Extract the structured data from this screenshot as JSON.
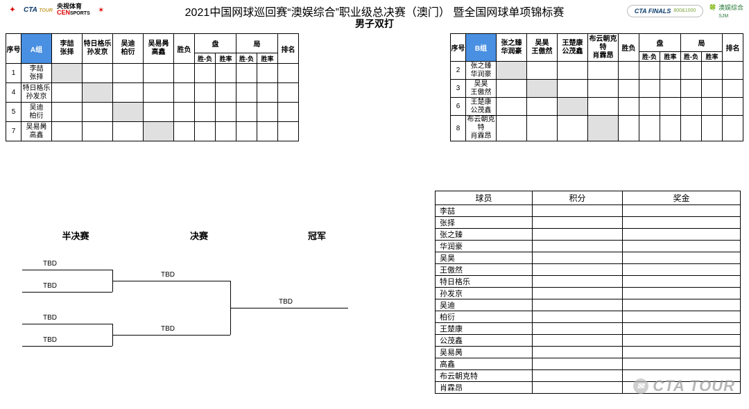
{
  "header": {
    "logos_left": {
      "cta_tour": "CTA",
      "tour": "TOUR",
      "cen_label_cn": "央视体育",
      "cen": "CEN",
      "sports": "SPORTS"
    },
    "title_main": "2021中国网球巡回赛“澳娱综合”职业级总决赛（澳门） 暨全国网球单项锦标赛",
    "title_sub": "男子双打",
    "logos_right": {
      "cta": "CTA",
      "finals": "FINALS",
      "finals_sub": "800&1000",
      "sjm_cn": "澳娱综合",
      "sjm": "SJM"
    }
  },
  "group_headers": {
    "seq": "序号",
    "win_loss": "胜负",
    "pan": "盘",
    "ju": "局",
    "sub_sf": "胜-负",
    "sub_sl": "胜率",
    "rank": "排名"
  },
  "groupA": {
    "label": "A组",
    "cols": [
      [
        "李喆",
        "张择"
      ],
      [
        "特日格乐",
        "孙发京"
      ],
      [
        "吴迪",
        "柏衍"
      ],
      [
        "吴易昺",
        "高鑫"
      ]
    ],
    "rows": [
      {
        "seq": "1",
        "pair": [
          "李喆",
          "张择"
        ],
        "diag": 0
      },
      {
        "seq": "4",
        "pair": [
          "特日格乐",
          "孙发京"
        ],
        "diag": 1
      },
      {
        "seq": "5",
        "pair": [
          "吴迪",
          "柏衍"
        ],
        "diag": 2
      },
      {
        "seq": "7",
        "pair": [
          "吴易昺",
          "高鑫"
        ],
        "diag": 3
      }
    ]
  },
  "groupB": {
    "label": "B组",
    "cols": [
      [
        "张之臻",
        "华润豪"
      ],
      [
        "吴昊",
        "王傲然"
      ],
      [
        "王楚康",
        "公茂鑫"
      ],
      [
        "布云朝克特",
        "肖霖昂"
      ]
    ],
    "rows": [
      {
        "seq": "2",
        "pair": [
          "张之臻",
          "华润豪"
        ],
        "diag": 0
      },
      {
        "seq": "3",
        "pair": [
          "吴昊",
          "王傲然"
        ],
        "diag": 1
      },
      {
        "seq": "6",
        "pair": [
          "王楚康",
          "公茂鑫"
        ],
        "diag": 2
      },
      {
        "seq": "8",
        "pair": [
          "布云朝克特",
          "肖霖昂"
        ],
        "diag": 3
      }
    ]
  },
  "bracket": {
    "sf_label": "半决赛",
    "f_label": "决赛",
    "champ_label": "冠军",
    "sf": [
      "TBD",
      "TBD",
      "TBD",
      "TBD"
    ],
    "f": [
      "TBD",
      "TBD"
    ],
    "champ": "TBD"
  },
  "standings": {
    "hdr_player": "球员",
    "hdr_points": "积分",
    "hdr_prize": "奖金",
    "players": [
      "李喆",
      "张择",
      "张之臻",
      "华润豪",
      "吴昊",
      "王傲然",
      "特日格乐",
      "孙发京",
      "吴迪",
      "柏衍",
      "王楚康",
      "公茂鑫",
      "吴易昺",
      "高鑫",
      "布云朝克特",
      "肖霖昂"
    ]
  },
  "watermark": "CTA TOUR"
}
